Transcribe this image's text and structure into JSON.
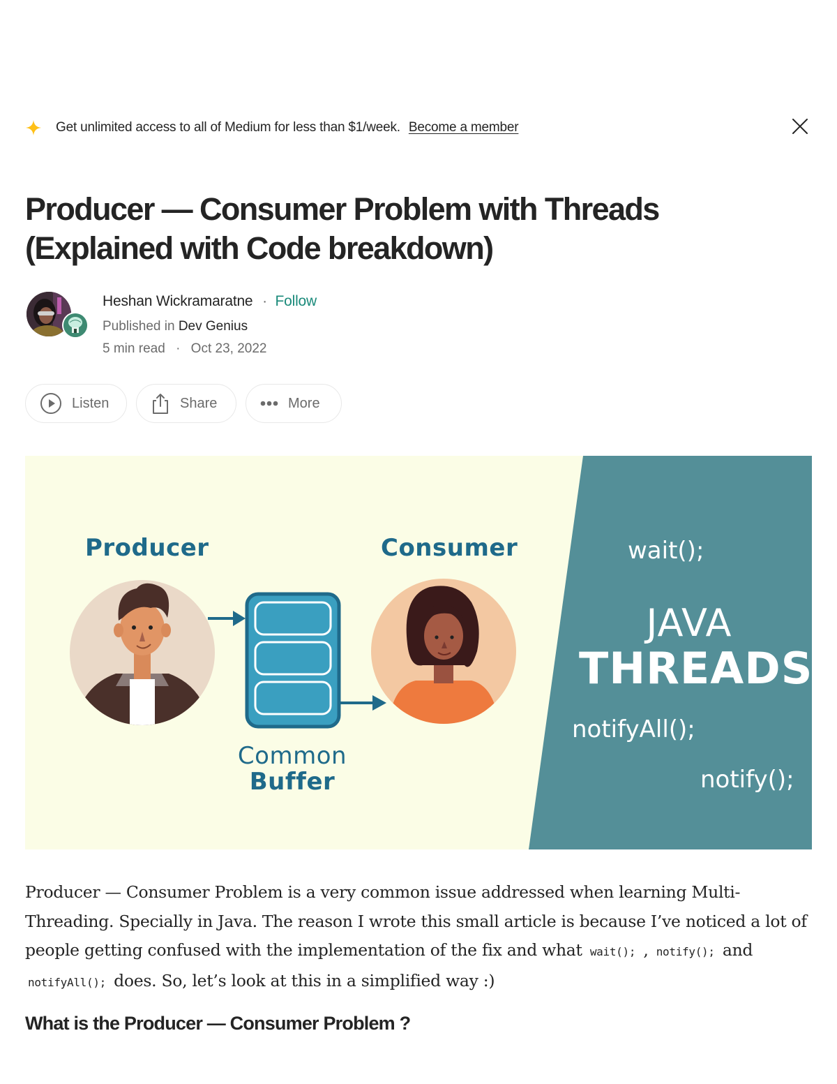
{
  "banner": {
    "icon": "sparkle-icon",
    "text": "Get unlimited access to all of Medium for less than $1/week.",
    "link": "Become a member",
    "close_icon": "close-icon",
    "accent": "#ffc017"
  },
  "article": {
    "title_line1": "Producer — Consumer Problem with Threads",
    "title_line2": "(Explained with Code breakdown)",
    "author": {
      "name": "Heshan Wickramaratne",
      "separator": "·",
      "follow": "Follow",
      "follow_color": "#1a8a7a",
      "published_prefix": "Published in",
      "publication": "Dev Genius",
      "read_time": "5 min read",
      "meta_separator": "·",
      "date": "Oct 23, 2022"
    },
    "actions": [
      {
        "icon": "play-circle-icon",
        "label": "Listen"
      },
      {
        "icon": "share-icon",
        "label": "Share"
      },
      {
        "icon": "more-dots-icon",
        "label": "More"
      }
    ],
    "hero": {
      "producer_label": "Producer",
      "consumer_label": "Consumer",
      "buffer_label_1": "Common",
      "buffer_label_2": "Buffer",
      "code_wait": "wait();",
      "java": "JAVA",
      "threads": "THREADS",
      "code_notifyall": "notifyAll();",
      "code_notify": "notify();",
      "bg_color": "#fbfde6",
      "panel_color": "#548f98",
      "label_color": "#1f6a8a"
    },
    "paragraph": {
      "part1": "Producer — Consumer Problem is a very common issue addressed when learning Multi-Threading. Specially in Java. The reason I wrote this small article is because I’ve noticed a lot of people getting confused with the implementation of the fix and what ",
      "code1": "wait();",
      "part2": " , ",
      "code2": "notify();",
      "part3": " and ",
      "code3": "notifyAll();",
      "part4": " does. So, let’s look at this in a simplified way :)"
    },
    "heading2": "What is the Producer — Consumer Problem ?"
  }
}
